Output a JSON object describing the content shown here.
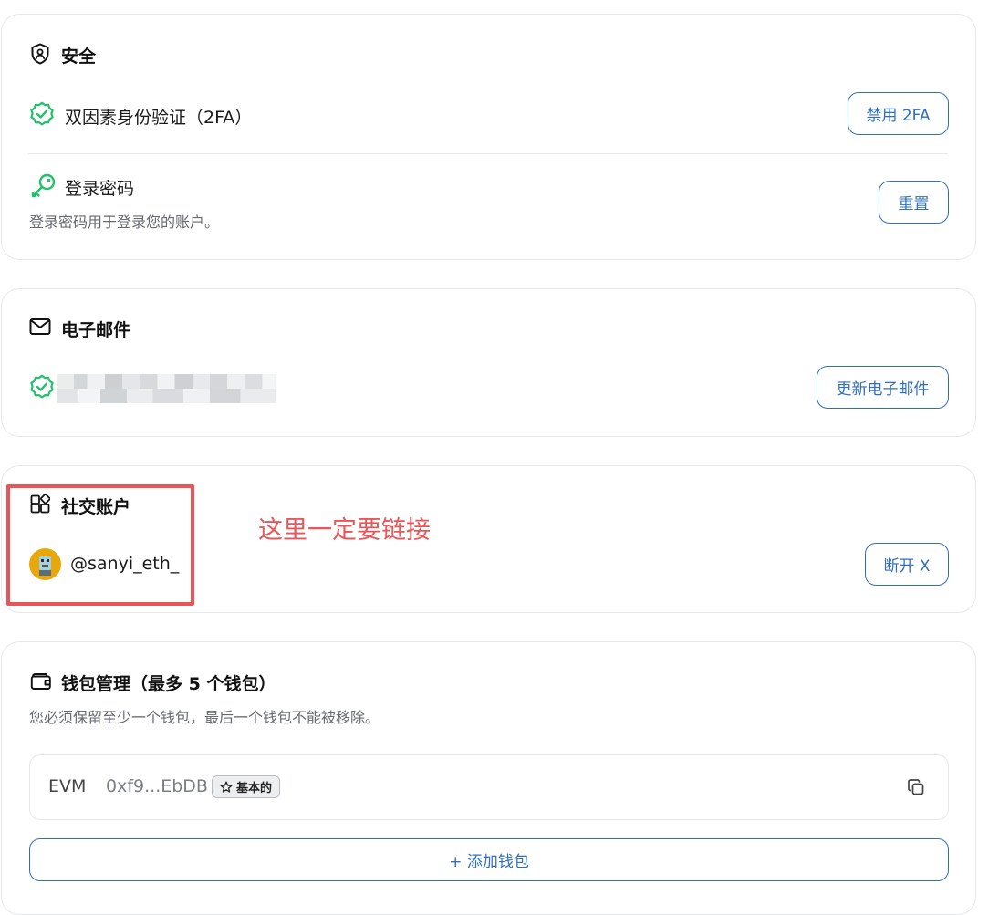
{
  "security": {
    "title": "安全",
    "two_fa": {
      "label": "双因素身份验证（2FA）",
      "button": "禁用 2FA"
    },
    "login_password": {
      "label": "登录密码",
      "description": "登录密码用于登录您的账户。",
      "button": "重置"
    }
  },
  "email": {
    "title": "电子邮件",
    "button": "更新电子邮件"
  },
  "social": {
    "title": "社交账户",
    "handle": "@sanyi_eth_",
    "button": "断开 X"
  },
  "annotation": {
    "text": "这里一定要链接"
  },
  "wallet": {
    "title": "钱包管理（最多 5 个钱包）",
    "description": "您必须保留至少一个钱包，最后一个钱包不能被移除。",
    "items": [
      {
        "chain": "EVM",
        "address": "0xf9...EbDB",
        "badge": "基本的"
      }
    ],
    "add_button": "+ 添加钱包"
  },
  "colors": {
    "accent": "#2f6fb9",
    "success": "#22c16b",
    "annotation": "#e8565a",
    "avatar_bg": "#e8a80c"
  },
  "icons": {
    "security": "shield-icon",
    "verified": "verified-badge-icon",
    "password": "key-icon",
    "email": "mail-icon",
    "social": "apps-icon",
    "wallet": "wallet-icon",
    "copy": "copy-icon",
    "star": "star-icon"
  }
}
